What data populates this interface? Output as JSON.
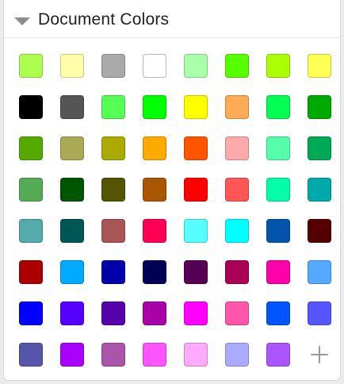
{
  "section": {
    "title": "Document Colors",
    "expanded": true
  },
  "colors": [
    [
      "#adff50",
      "#ffffaa",
      "#aaaaaa",
      "#ffffff",
      "#aaffaa",
      "#55ff00",
      "#aaff00",
      "#ffff55"
    ],
    [
      "#000000",
      "#555555",
      "#55ff55",
      "#00ff00",
      "#ffff00",
      "#ffaa55",
      "#00ff55",
      "#00aa00"
    ],
    [
      "#55aa00",
      "#aaaa55",
      "#aaaa00",
      "#ffaa00",
      "#ff5500",
      "#ffaaaa",
      "#55ffaa",
      "#00aa55"
    ],
    [
      "#55aa55",
      "#005500",
      "#555500",
      "#aa5500",
      "#ff0000",
      "#ff5555",
      "#00ffaa",
      "#00aaaa"
    ],
    [
      "#55aaaa",
      "#005555",
      "#aa5555",
      "#ff0055",
      "#55ffff",
      "#00ffff",
      "#0055aa",
      "#550000"
    ],
    [
      "#aa0000",
      "#00aaff",
      "#0000aa",
      "#000055",
      "#550055",
      "#aa0055",
      "#ff00aa",
      "#55aaff"
    ],
    [
      "#0000ff",
      "#5500ff",
      "#5500aa",
      "#aa00aa",
      "#ff00ff",
      "#ff55aa",
      "#0055ff",
      "#5555ff"
    ],
    [
      "#5555aa",
      "#aa00ff",
      "#aa55aa",
      "#ff55ff",
      "#ffaaff",
      "#aaaaff",
      "#aa55ff"
    ]
  ],
  "add_button": {
    "icon": "plus-icon"
  }
}
